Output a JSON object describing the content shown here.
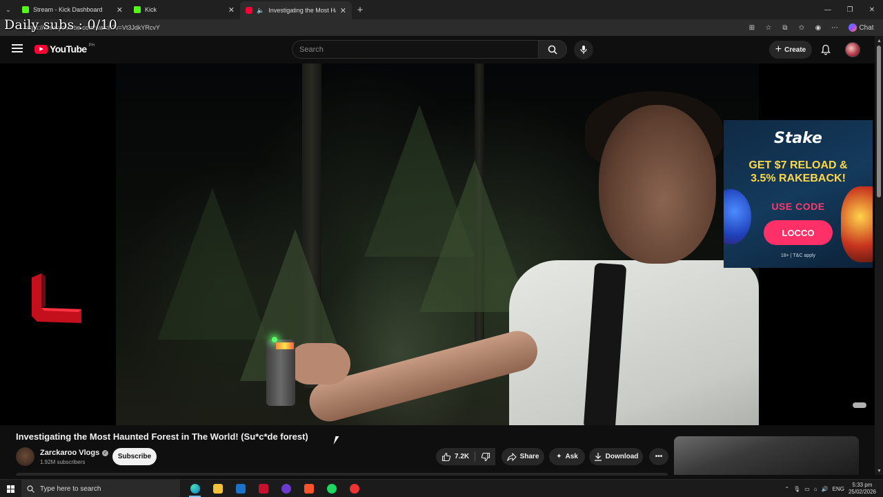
{
  "overlay": {
    "daily_subs": "Daily subs : 0/10"
  },
  "browser": {
    "tabs": [
      {
        "title": "Stream - Kick Dashboard",
        "icon": "kick-icon"
      },
      {
        "title": "Kick",
        "icon": "kick-icon"
      },
      {
        "title": "Investigating the Most Haunted",
        "icon": "youtube-icon",
        "active": true
      }
    ],
    "url": "https://www.youtube.com/watch?v=Vt3JdkYRcvY",
    "chat_label": "Chat"
  },
  "youtube": {
    "logo_text": "YouTube",
    "country_code": "PH",
    "search_placeholder": "Search",
    "create_label": "Create"
  },
  "ad": {
    "brand": "Stake",
    "headline": "GET $7 RELOAD & 3.5% RAKEBACK!",
    "use_code": "USE CODE",
    "code": "LOCCO",
    "terms": "18+ | T&C apply"
  },
  "video": {
    "title": "Investigating the Most Haunted Forest in The World! (Su*c*de forest)",
    "channel_name": "Zarckaroo Vlogs",
    "subscribers": "1.92M subscribers",
    "subscribe_label": "Subscribe",
    "likes": "7.2K",
    "share_label": "Share",
    "ask_label": "Ask",
    "download_label": "Download"
  },
  "taskbar": {
    "search_placeholder": "Type here to search",
    "language": "ENG",
    "time": "5:33 pm",
    "date": "25/02/2026"
  },
  "colors": {
    "youtube_red": "#ff0033",
    "kick_green": "#53fc18",
    "bg": "#0f0f0f"
  }
}
